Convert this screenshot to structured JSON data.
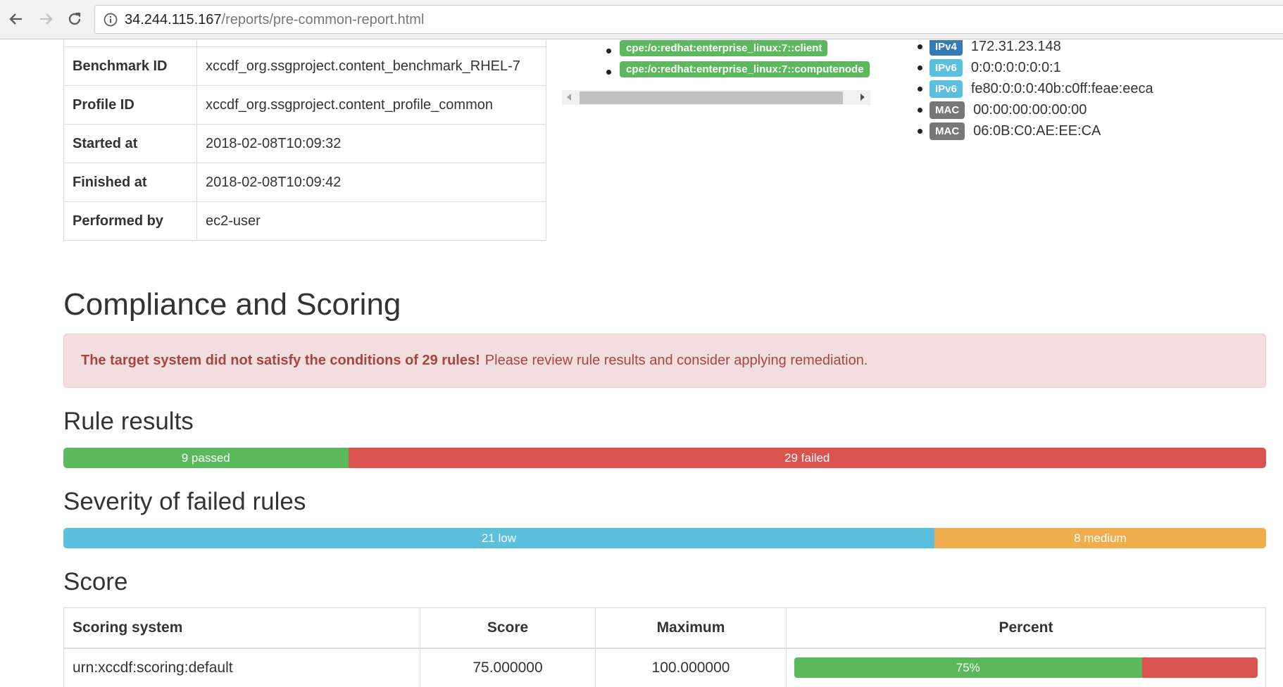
{
  "browser": {
    "url_host": "34.244.115.167",
    "url_path": "/reports/pre-common-report.html"
  },
  "characteristics": {
    "rows": [
      {
        "key": "Benchmark ID",
        "value": "xccdf_org.ssgproject.content_benchmark_RHEL-7"
      },
      {
        "key": "Profile ID",
        "value": "xccdf_org.ssgproject.content_profile_common"
      },
      {
        "key": "Started at",
        "value": "2018-02-08T10:09:32"
      },
      {
        "key": "Finished at",
        "value": "2018-02-08T10:09:42"
      },
      {
        "key": "Performed by",
        "value": "ec2-user"
      }
    ]
  },
  "cpe_platforms": [
    "cpe:/o:redhat:enterprise_linux:7::client",
    "cpe:/o:redhat:enterprise_linux:7::computenode"
  ],
  "addresses": [
    {
      "type": "IPv4",
      "value": "172.31.23.148",
      "style": "primary"
    },
    {
      "type": "IPv6",
      "value": "0:0:0:0:0:0:0:1",
      "style": "info"
    },
    {
      "type": "IPv6",
      "value": "fe80:0:0:0:40b:c0ff:feae:eeca",
      "style": "info"
    },
    {
      "type": "MAC",
      "value": "00:00:00:00:00:00",
      "style": "default"
    },
    {
      "type": "MAC",
      "value": "06:0B:C0:AE:EE:CA",
      "style": "default"
    }
  ],
  "compliance": {
    "title": "Compliance and Scoring",
    "alert_strong": "The target system did not satisfy the conditions of 29 rules!",
    "alert_text": "Please review rule results and consider applying remediation."
  },
  "rule_results": {
    "title": "Rule results",
    "passed": 9,
    "failed": 29,
    "passed_label": "9 passed",
    "failed_label": "29 failed"
  },
  "severity": {
    "title": "Severity of failed rules",
    "low": 21,
    "medium": 8,
    "low_label": "21 low",
    "medium_label": "8 medium"
  },
  "score": {
    "title": "Score",
    "headers": [
      "Scoring system",
      "Score",
      "Maximum",
      "Percent"
    ],
    "rows": [
      {
        "system": "urn:xccdf:scoring:default",
        "score": "75.000000",
        "maximum": "100.000000",
        "percent": 75,
        "percent_label": "75%"
      }
    ]
  },
  "colors": {
    "success": "#5cb85c",
    "danger": "#d9534f",
    "info": "#5bc0de",
    "warning": "#f0ad4e",
    "primary": "#337ab7"
  }
}
